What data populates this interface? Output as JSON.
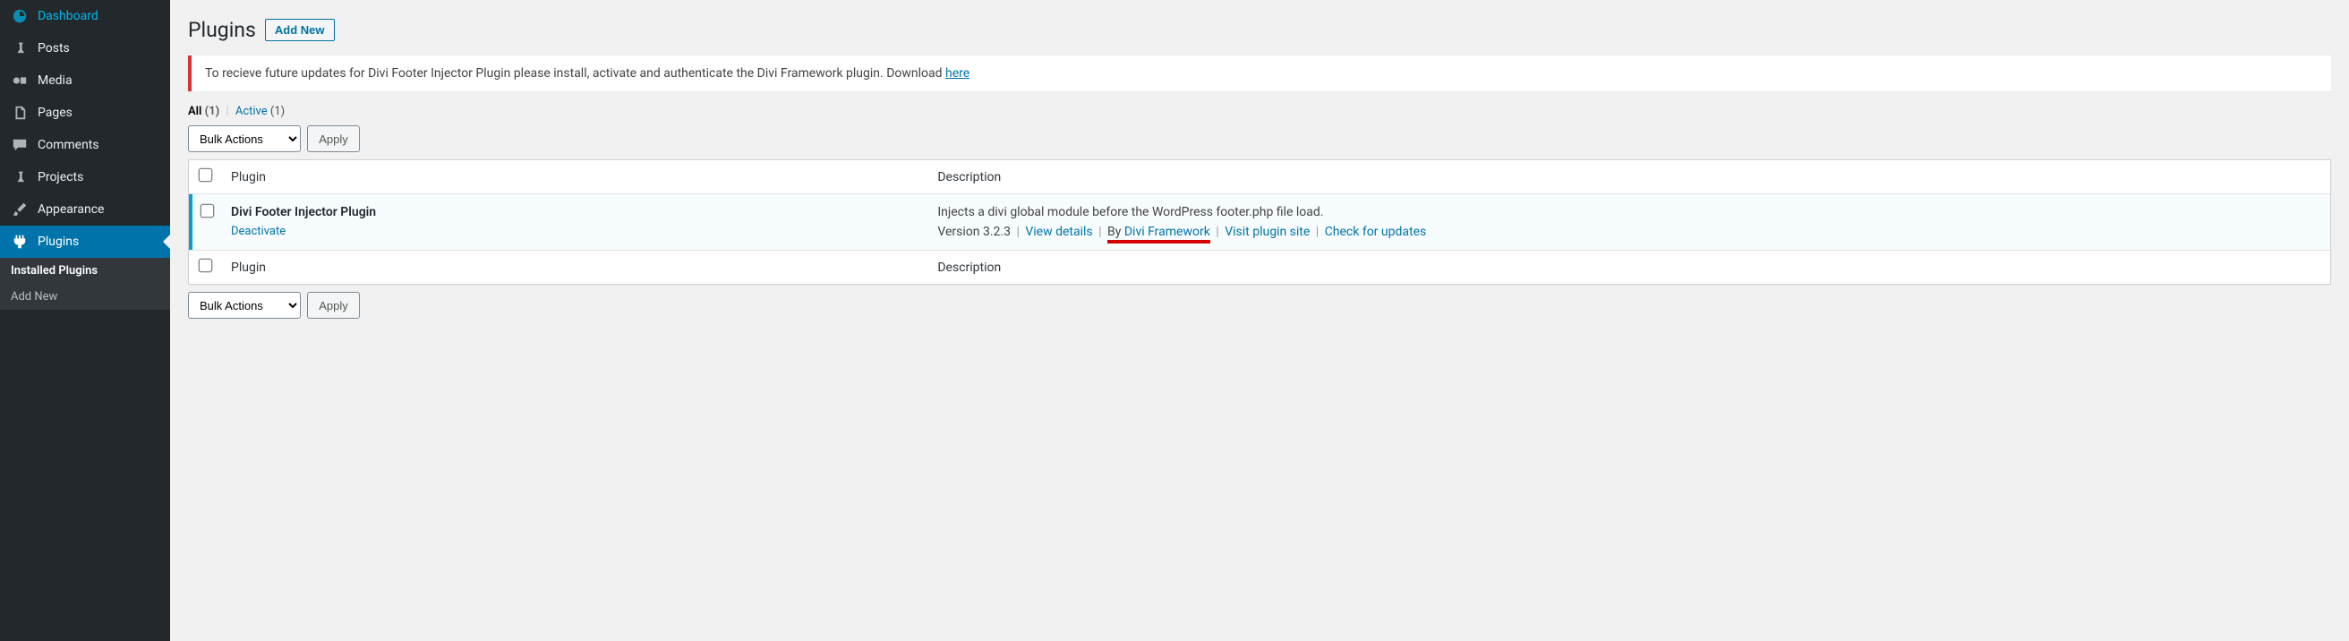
{
  "sidebar": {
    "items": [
      {
        "label": "Dashboard",
        "icon": "dashboard"
      },
      {
        "label": "Posts",
        "icon": "pin"
      },
      {
        "label": "Media",
        "icon": "media"
      },
      {
        "label": "Pages",
        "icon": "pages"
      },
      {
        "label": "Comments",
        "icon": "comment"
      },
      {
        "label": "Projects",
        "icon": "pin"
      },
      {
        "label": "Appearance",
        "icon": "brush"
      },
      {
        "label": "Plugins",
        "icon": "plug"
      }
    ],
    "submenu": [
      {
        "label": "Installed Plugins"
      },
      {
        "label": "Add New"
      }
    ]
  },
  "page": {
    "title": "Plugins",
    "add_new": "Add New"
  },
  "notice": {
    "text": "To recieve future updates for Divi Footer Injector Plugin please install, activate and authenticate the Divi Framework plugin. Download ",
    "link": "here"
  },
  "filters": {
    "all_label": "All",
    "all_count": "(1)",
    "active_label": "Active",
    "active_count": "(1)"
  },
  "bulk": {
    "select_label": "Bulk Actions",
    "apply": "Apply"
  },
  "table": {
    "col_plugin": "Plugin",
    "col_description": "Description",
    "rows": [
      {
        "name": "Divi Footer Injector Plugin",
        "action": "Deactivate",
        "description": "Injects a divi global module before the WordPress footer.php file load.",
        "version_text": "Version 3.2.3",
        "view_details": "View details",
        "by": "By ",
        "author": "Divi Framework",
        "visit": "Visit plugin site",
        "check": "Check for updates"
      }
    ]
  }
}
